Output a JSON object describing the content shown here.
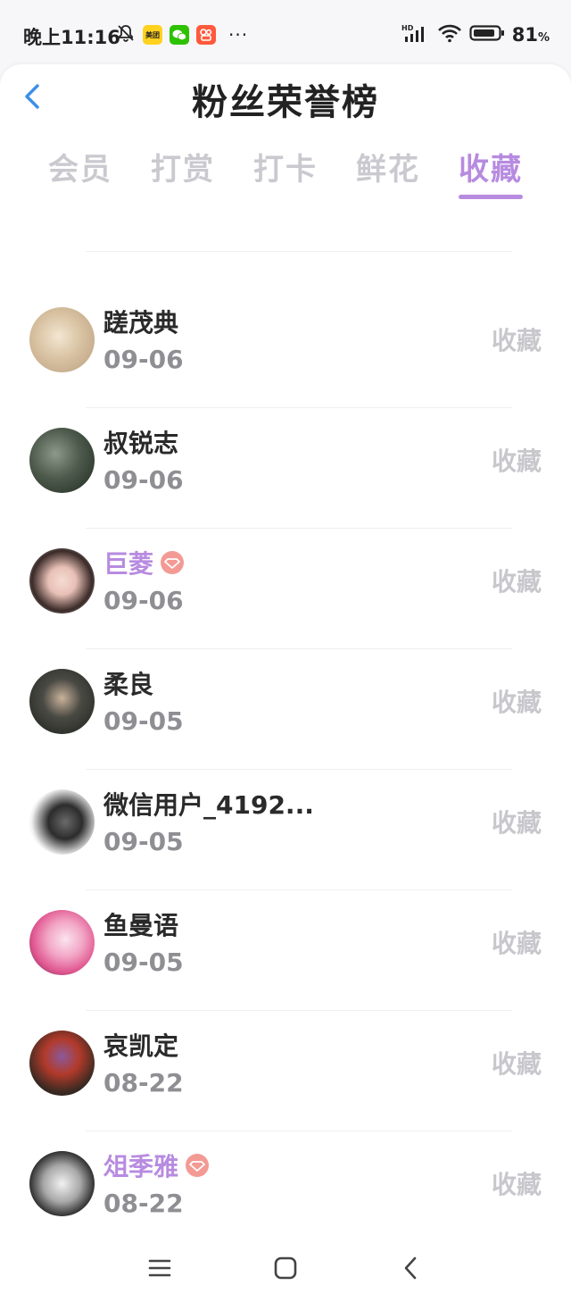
{
  "status_bar": {
    "time": "晚上11:16",
    "app_icons": [
      "mute-bell-icon",
      "meituan-app-icon",
      "wechat-app-icon",
      "kuaishou-app-icon"
    ],
    "meituan_label": "美团",
    "more": "···",
    "signal_label": "HD",
    "battery": "81",
    "battery_unit": "%"
  },
  "header": {
    "title": "粉丝荣誉榜"
  },
  "tabs": [
    {
      "label": "会员",
      "active": false
    },
    {
      "label": "打赏",
      "active": false
    },
    {
      "label": "打卡",
      "active": false
    },
    {
      "label": "鲜花",
      "active": false
    },
    {
      "label": "收藏",
      "active": true
    }
  ],
  "colors": {
    "accent": "#b78be0",
    "vip_badge": "#f39a94",
    "date_text": "#8e8e93",
    "action_text": "#c7c7cc"
  },
  "list": [
    {
      "name": "",
      "date": "09-06",
      "action": "收藏",
      "vip": false
    },
    {
      "name": "蹉茂典",
      "date": "09-06",
      "action": "收藏",
      "vip": false
    },
    {
      "name": "叔锐志",
      "date": "09-06",
      "action": "收藏",
      "vip": false
    },
    {
      "name": "巨菱",
      "date": "09-06",
      "action": "收藏",
      "vip": true
    },
    {
      "name": "柔良",
      "date": "09-05",
      "action": "收藏",
      "vip": false
    },
    {
      "name": "微信用户_4192...",
      "date": "09-05",
      "action": "收藏",
      "vip": false
    },
    {
      "name": "鱼曼语",
      "date": "09-05",
      "action": "收藏",
      "vip": false
    },
    {
      "name": "哀凯定",
      "date": "08-22",
      "action": "收藏",
      "vip": false
    },
    {
      "name": "俎季雅",
      "date": "08-22",
      "action": "收藏",
      "vip": true
    }
  ]
}
